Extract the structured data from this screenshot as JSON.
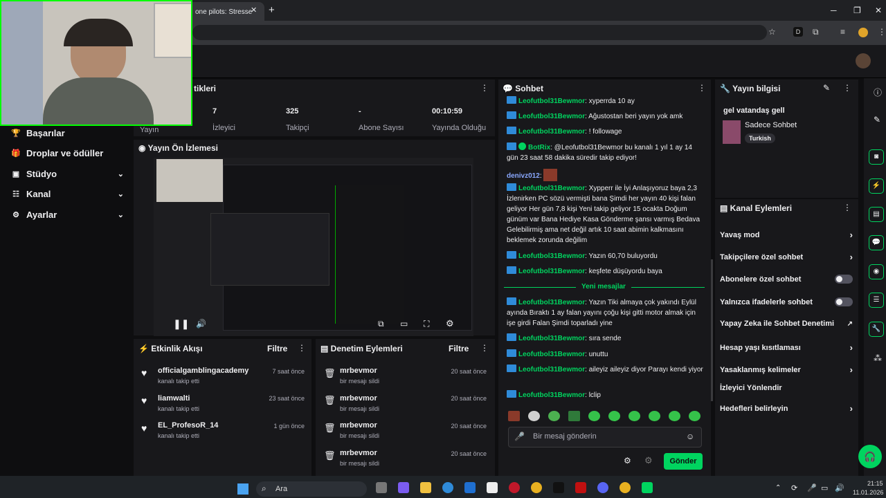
{
  "browser": {
    "tab_title": "one pilots: Stresse",
    "tab_close": "✕",
    "new_tab": "+",
    "min": "─",
    "max": "❐",
    "close": "✕"
  },
  "sidebar": {
    "items": [
      {
        "label": "Başarılar",
        "icon": "trophy-icon"
      },
      {
        "label": "Droplar ve ödüller",
        "icon": "gift-icon"
      },
      {
        "label": "Stüdyo",
        "icon": "studio-icon"
      },
      {
        "label": "Kanal",
        "icon": "channel-icon"
      },
      {
        "label": "Ayarlar",
        "icon": "gear-icon"
      }
    ],
    "chevron": "⌄"
  },
  "stats": {
    "title_partial": "tikleri",
    "cut_label": "Yayın",
    "items": [
      {
        "value": "7",
        "label": "İzleyici"
      },
      {
        "value": "325",
        "label": "Takipçi"
      },
      {
        "value": "-",
        "label": "Abone Sayısı"
      },
      {
        "value": "00:10:59",
        "label": "Yayında Olduğu"
      }
    ]
  },
  "preview": {
    "title": "Yayın Ön İzlemesi"
  },
  "activity": {
    "title": "Etkinlik Akışı",
    "filter": "Filtre",
    "items": [
      {
        "name": "officialgamblingacademy",
        "sub": "kanalı takip etti",
        "time": "7 saat önce"
      },
      {
        "name": "liamwalti",
        "sub": "kanalı takip etti",
        "time": "23 saat önce"
      },
      {
        "name": "EL_ProfesoR_14",
        "sub": "kanalı takip etti",
        "time": "1 gün önce"
      }
    ]
  },
  "moderation": {
    "title": "Denetim Eylemleri",
    "filter": "Filtre",
    "items": [
      {
        "name": "mrbevmor",
        "sub": "bir mesajı sildi",
        "time": "20 saat önce"
      },
      {
        "name": "mrbevmor",
        "sub": "bir mesajı sildi",
        "time": "20 saat önce"
      },
      {
        "name": "mrbevmor",
        "sub": "bir mesajı sildi",
        "time": "20 saat önce"
      },
      {
        "name": "mrbevmor",
        "sub": "bir mesajı sildi",
        "time": "20 saat önce"
      }
    ]
  },
  "chat": {
    "title": "Sohbet",
    "new_messages": "Yeni mesajlar",
    "input_placeholder": "Bir mesaj gönderin",
    "send": "Gönder",
    "messages": [
      {
        "user": "Leofutbol31Bewmor",
        "text": "xyperrda 10 ay"
      },
      {
        "user": "Leofutbol31Bewmor",
        "text": "Ağustostan beri yayın yok amk"
      },
      {
        "user": "Leofutbol31Bewmor",
        "text": "! followage"
      },
      {
        "user": "BotRix",
        "text": "@Leofutbol31Bewmor bu kanalı 1 yıl 1 ay 14 gün 23 saat 58 dakika süredir takip ediyor!"
      },
      {
        "user": "denivz012",
        "text": ""
      },
      {
        "user": "Leofutbol31Bewmor",
        "text": "Xypperr ile İyi Anlaşıyoruz baya 2,3 İzlenirken PC sözü vermişti bana Şimdi her yayın 40 kişi falan geliyor Her gün 7,8 kişi Yeni takip geliyor 15 ocakta Doğum günüm var Bana Hediye Kasa Gönderme şansı varmış Bedava Gelebilirmiş ama net değil artık 10 saat abimin kalkmasını beklemek zorunda değilim"
      },
      {
        "user": "Leofutbol31Bewmor",
        "text": "Yazın 60,70 buluyordu"
      },
      {
        "user": "Leofutbol31Bewmor",
        "text": "keşfete düşüyordu baya"
      },
      {
        "user": "Leofutbol31Bewmor",
        "text": "Yazın Tiki almaya çok yakındı Eylül ayında Bıraktı 1 ay falan yayını çoğu kişi gitti motor almak için işe girdi Falan Şimdi toparladı yine"
      },
      {
        "user": "Leofutbol31Bewmor",
        "text": "sıra sende"
      },
      {
        "user": "Leofutbol31Bewmor",
        "text": "unuttu"
      },
      {
        "user": "Leofutbol31Bewmor",
        "text": "aileyiz aileyiz diyor Parayı kendi yiyor"
      },
      {
        "user": "Leofutbol31Bewmor",
        "text": "lclip"
      }
    ]
  },
  "stream_info": {
    "title": "Yayın bilgisi",
    "stream_title": "gel vatandaş gell",
    "category": "Sadece Sohbet",
    "tag": "Turkish"
  },
  "channel_actions": {
    "title": "Kanal Eylemleri",
    "items": [
      {
        "label": "Yavaş mod",
        "kind": "arrow"
      },
      {
        "label": "Takipçilere özel sohbet",
        "kind": "arrow"
      },
      {
        "label": "Abonelere özel sohbet",
        "kind": "toggle"
      },
      {
        "label": "Yalnızca ifadelerle sohbet",
        "kind": "toggle"
      },
      {
        "label": "Yapay Zeka ile Sohbet Denetimi",
        "kind": "external"
      },
      {
        "label": "Hesap yaşı kısıtlaması",
        "kind": "arrow"
      },
      {
        "label": "Yasaklanmış kelimeler",
        "kind": "arrow"
      },
      {
        "label": "İzleyici Yönlendir",
        "kind": "none"
      },
      {
        "label": "Hedefleri belirleyin",
        "kind": "arrow"
      }
    ]
  },
  "taskbar": {
    "search": "Ara",
    "time": "21:15",
    "date": "11.01.2026"
  },
  "colors": {
    "accent": "#00d45f",
    "panel": "#18181b",
    "bg": "#0e0e10"
  }
}
